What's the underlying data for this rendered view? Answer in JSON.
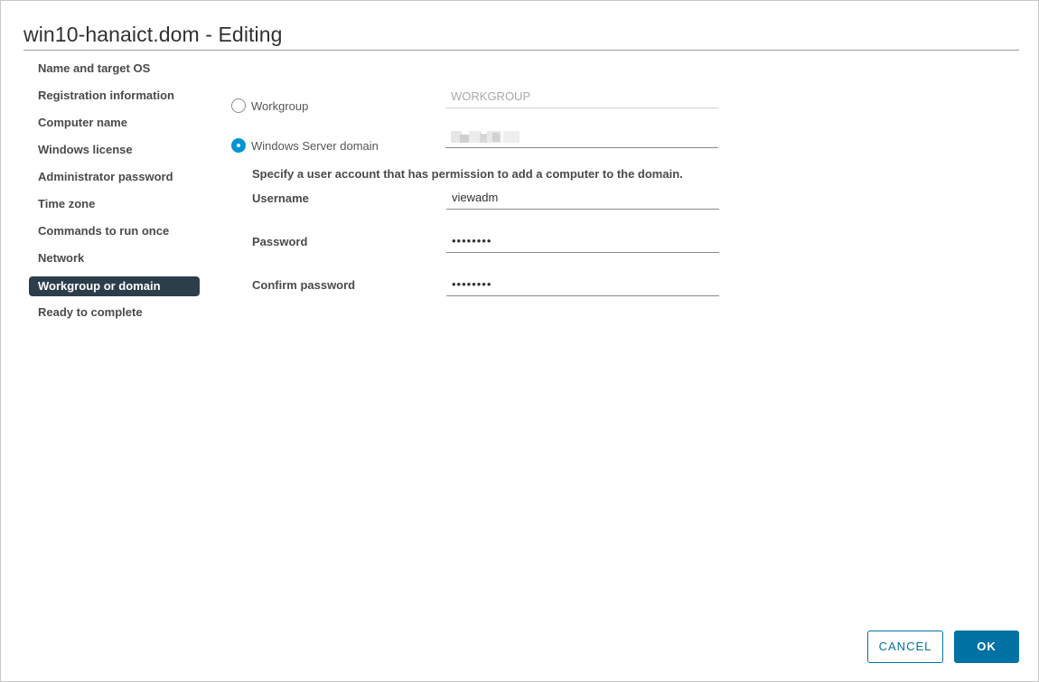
{
  "dialog": {
    "title": "win10-hanaict.dom - Editing"
  },
  "nav": {
    "items": [
      {
        "label": "Name and target OS"
      },
      {
        "label": "Registration information"
      },
      {
        "label": "Computer name"
      },
      {
        "label": "Windows license"
      },
      {
        "label": "Administrator password"
      },
      {
        "label": "Time zone"
      },
      {
        "label": "Commands to run once"
      },
      {
        "label": "Network"
      },
      {
        "label": "Workgroup or domain",
        "active": true
      },
      {
        "label": "Ready to complete"
      }
    ]
  },
  "form": {
    "workgroup": {
      "label": "Workgroup",
      "checked": false,
      "value": "WORKGROUP"
    },
    "domain": {
      "label": "Windows Server domain",
      "checked": true,
      "value": ""
    },
    "hint": "Specify a user account that has permission to add a computer to the domain.",
    "username": {
      "label": "Username",
      "value": "viewadm"
    },
    "password": {
      "label": "Password",
      "value": "••••••••"
    },
    "confirm_password": {
      "label": "Confirm password",
      "value": "••••••••"
    }
  },
  "footer": {
    "cancel_label": "CANCEL",
    "ok_label": "OK"
  },
  "colors": {
    "active_nav_bg": "#2d3e4b",
    "radio_checked": "#0094d2",
    "primary_button": "#0072a3"
  }
}
